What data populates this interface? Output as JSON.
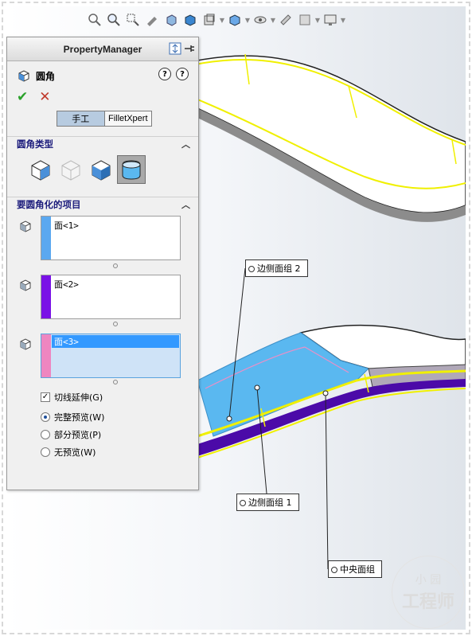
{
  "hud_icons": [
    "zoom-to-fit-icon",
    "zoom-area-icon",
    "zoom-selection-icon",
    "previous-view-icon",
    "section-view-icon",
    "view-orientation-icon",
    "display-style-icon",
    "hide-show-icon",
    "edit-appearance-icon",
    "apply-scene-icon",
    "view-settings-icon"
  ],
  "property_manager": {
    "title": "PropertyManager",
    "feature_name": "圆角",
    "mode_manual": "手工",
    "mode_filletxpert": "FilletXpert",
    "fillet_type_group": "圆角类型",
    "items_group": "要圆角化的项目",
    "selections": [
      {
        "label": "面<1>",
        "color": "#5ba8f0"
      },
      {
        "label": "面<2>",
        "color": "#7a12e6"
      },
      {
        "label": "面<3>",
        "color": "#ee86c0"
      }
    ],
    "tangent_propagation": "切线延伸(G)",
    "preview_full": "完整预览(W)",
    "preview_partial": "部分预览(P)",
    "preview_none": "无预览(W)"
  },
  "callouts": {
    "side_face_set_2": "边侧面组 2",
    "side_face_set_1": "边侧面组 1",
    "center_face_set": "中央面组"
  },
  "watermark": {
    "line1": "小   园",
    "line2": "工程师"
  },
  "colors": {
    "panel_bg": "#f0f0f0",
    "model_blue": "#5ab8f0",
    "edge_yellow": "#f0f000",
    "purple": "#4b0aa8"
  }
}
